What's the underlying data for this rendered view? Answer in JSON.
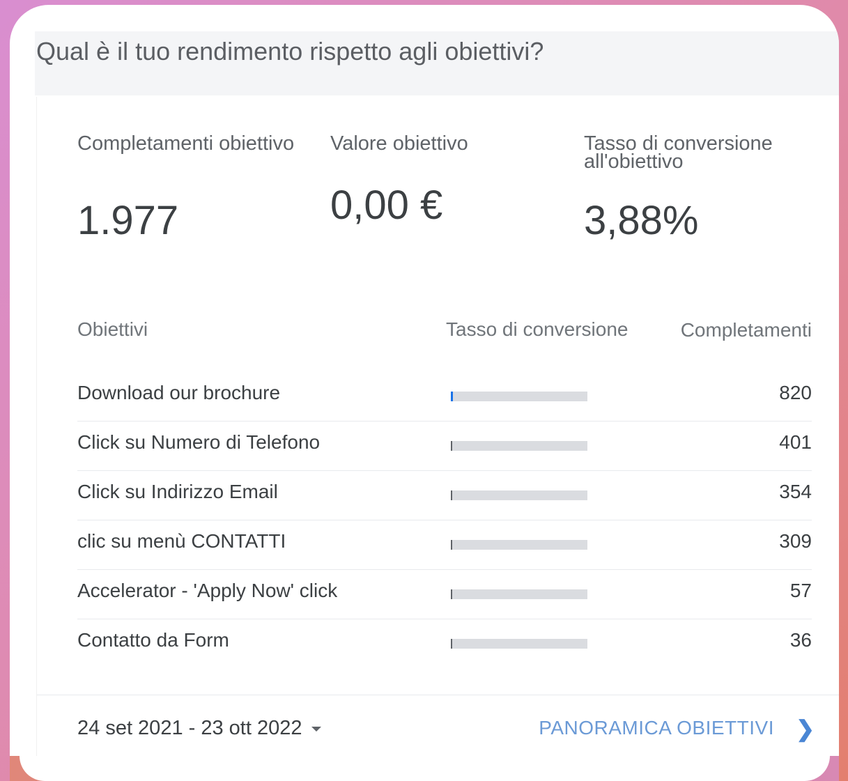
{
  "page": {
    "title": "Qual è il tuo rendimento rispetto agli obiettivi?"
  },
  "metrics": [
    {
      "label": "Completamenti obiettivo",
      "value": "1.977"
    },
    {
      "label": "Valore obiettivo",
      "value": "0,00 €"
    },
    {
      "label": "Tasso di conversione all'obiettivo",
      "value": "3,88%"
    }
  ],
  "table": {
    "headers": {
      "goals": "Obiettivi",
      "rate": "Tasso di conversione",
      "completions": "Completamenti"
    },
    "rows": [
      {
        "name": "Download our brochure",
        "rate_fraction": 0.015,
        "value": "820"
      },
      {
        "name": "Click su Numero di Telefono",
        "rate_fraction": 0.008,
        "value": "401"
      },
      {
        "name": "Click su Indirizzo Email",
        "rate_fraction": 0.007,
        "value": "354"
      },
      {
        "name": "clic su menù CONTATTI",
        "rate_fraction": 0.006,
        "value": "309"
      },
      {
        "name": "Accelerator - 'Apply Now' click",
        "rate_fraction": 0.001,
        "value": "57"
      },
      {
        "name": "Contatto da Form",
        "rate_fraction": 0.001,
        "value": "36"
      }
    ]
  },
  "footer": {
    "date_range": "24 set 2021 - 23 ott 2022",
    "overview_link": "PANORAMICA OBIETTIVI",
    "dropdown_icon": "caret-down-icon",
    "link_icon": "chevron-right-icon"
  },
  "colors": {
    "accent": "#1a73e8",
    "link": "#6b9ad6"
  }
}
